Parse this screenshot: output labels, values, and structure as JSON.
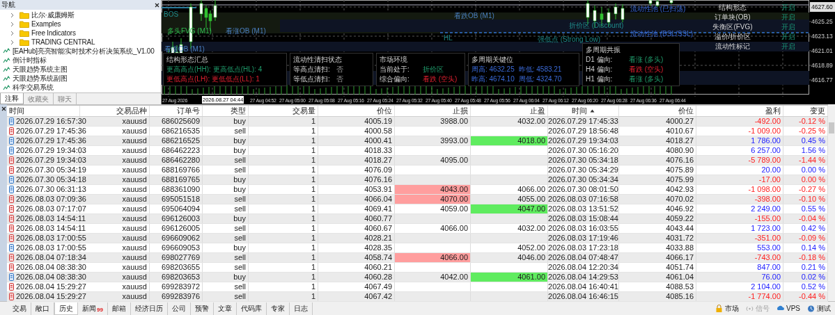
{
  "navigator": {
    "title": "导航",
    "items": [
      {
        "kind": "folder",
        "label": "比尔·威廉姆斯"
      },
      {
        "kind": "folder",
        "label": "Examples"
      },
      {
        "kind": "folder",
        "label": "Free Indicators"
      },
      {
        "kind": "folder",
        "label": "TRADING CENTRAL"
      },
      {
        "kind": "indicator",
        "label": "[EAHub]亮亮智能实时技术分析决策系统_V1.00"
      },
      {
        "kind": "indicator",
        "label": "倒计时指标"
      },
      {
        "kind": "indicator",
        "label": "天眼趋势系统主图"
      },
      {
        "kind": "indicator",
        "label": "天眼趋势系统副图"
      },
      {
        "kind": "indicator",
        "label": "科学交易系统"
      }
    ],
    "tabs": [
      {
        "label": "注释",
        "selected": true
      },
      {
        "label": "收藏夹",
        "selected": false
      },
      {
        "label": "聊天",
        "selected": false
      }
    ]
  },
  "chart": {
    "labels": [
      {
        "text": "BOS"
      },
      {
        "text": "多头FVG (M1)"
      },
      {
        "text": "看涨OB (M1)"
      },
      {
        "text": "看涨OB (M1)"
      },
      {
        "text": "看跌OB (M1)"
      },
      {
        "text": "HL"
      },
      {
        "text": "流动性池 (已扫荡)"
      },
      {
        "text": "折价区 (Discount)"
      },
      {
        "text": "流动性池 (BSL/SSL)"
      },
      {
        "text": "强低点 (Strong Low)"
      }
    ],
    "toggles": [
      {
        "label": "结构形态",
        "state": "开启"
      },
      {
        "label": "订单块(OB)",
        "state": "开启"
      },
      {
        "label": "失衡区(FVG)",
        "state": "开启"
      },
      {
        "label": "溢价/折价区",
        "state": "开启"
      },
      {
        "label": "流动性标记",
        "state": "开启"
      }
    ],
    "panels": [
      {
        "title": "结构形态汇总",
        "rows": [
          {
            "text": "更高高点(HH): 更高低点(HL): 4"
          },
          {
            "text": "更低高点(LH): 更低低点(LL): 1"
          }
        ]
      },
      {
        "title": "流动性清扫状态",
        "rows": [
          {
            "text": "等高点清扫:",
            "value": "否"
          },
          {
            "text": "等低点清扫:",
            "value": "否"
          }
        ]
      },
      {
        "title": "市场环境",
        "rows": [
          {
            "text": "当前处于:",
            "value": "折价区"
          },
          {
            "text": "综合偏向:",
            "value": "看跌 (空头)"
          }
        ]
      },
      {
        "title": "多周期关键位",
        "rows": [
          {
            "text": "周高: 4632.25",
            "value": "昨低: 4583.21"
          },
          {
            "text": "昨高: 4674.10",
            "value": "周低: 4324.70"
          }
        ]
      },
      {
        "title": "多周期共振",
        "rows": [
          {
            "text": "D1 偏向:",
            "value": "看涨 (多头)"
          },
          {
            "text": "H4 偏向:",
            "value": "看跌 (空头)"
          },
          {
            "text": "H1 偏向:",
            "value": "看涨 (多头)"
          }
        ]
      }
    ],
    "price_axis": [
      {
        "text": "4627.60",
        "selected": true
      },
      {
        "text": "4625.25",
        "selected": false
      },
      {
        "text": "4623.13",
        "selected": false
      },
      {
        "text": "4621.01",
        "selected": false
      },
      {
        "text": "4618.89",
        "selected": false
      },
      {
        "text": "4616.77",
        "selected": false
      }
    ],
    "time_axis": [
      "27 Aug 2026",
      "27 Aug 04:52",
      "27 Aug 05:00",
      "27 Aug 05:08",
      "27 Aug 05:16",
      "27 Aug 05:24",
      "27 Aug 05:32",
      "27 Aug 05:40",
      "27 Aug 05:48",
      "27 Aug 05:56",
      "27 Aug 06:04",
      "27 Aug 06:12",
      "27 Aug 06:20",
      "27 Aug 06:28",
      "27 Aug 06:36",
      "27 Aug 06:44"
    ],
    "crosshair_time": "2026.08.27 04:44"
  },
  "table": {
    "columns": [
      "时间",
      "交易品种",
      "订单号",
      "类型",
      "交易量",
      "价位",
      "止损",
      "止盈",
      "时间",
      "价位",
      "盈利",
      "变更"
    ],
    "rows": [
      {
        "kind": "buy",
        "time": "2026.07.29 16:57:30",
        "symbol": "xauusd",
        "order": "686025609",
        "type": "buy",
        "volume": "1",
        "price": "4005.19",
        "sl": "3988.00",
        "tp": "4032.00",
        "sl_hit": false,
        "tp_hit": false,
        "close_time": "2026.07.29 17:45:33",
        "close_price": "4000.27",
        "profit": "-492.00",
        "change": "-0.12 %",
        "loss": true
      },
      {
        "kind": "sell",
        "time": "2026.07.29 17:45:36",
        "symbol": "xauusd",
        "order": "686216535",
        "type": "sell",
        "volume": "1",
        "price": "4000.58",
        "sl_hit": false,
        "tp_hit": false,
        "close_time": "2026.07.29 18:56:48",
        "close_price": "4010.67",
        "profit": "-1 009.00",
        "change": "-0.25 %",
        "loss": true
      },
      {
        "kind": "buy",
        "time": "2026.07.29 17:45:36",
        "symbol": "xauusd",
        "order": "686216525",
        "type": "buy",
        "volume": "1",
        "price": "4000.41",
        "sl": "3993.00",
        "tp": "4018.00",
        "sl_hit": false,
        "tp_hit": true,
        "close_time": "2026.07.29 19:34:03",
        "close_price": "4018.27",
        "profit": "1 786.00",
        "change": "0.45 %",
        "loss": false
      },
      {
        "kind": "buy",
        "time": "2026.07.29 19:34:03",
        "symbol": "xauusd",
        "order": "686462223",
        "type": "buy",
        "volume": "1",
        "price": "4018.33",
        "sl_hit": false,
        "tp_hit": false,
        "close_time": "2026.07.30 05:16:20",
        "close_price": "4080.90",
        "profit": "6 257.00",
        "change": "1.56 %",
        "loss": false
      },
      {
        "kind": "sell",
        "time": "2026.07.29 19:34:03",
        "symbol": "xauusd",
        "order": "686462280",
        "type": "sell",
        "volume": "1",
        "price": "4018.27",
        "sl": "4095.00",
        "sl_hit": false,
        "tp_hit": false,
        "close_time": "2026.07.30 05:34:18",
        "close_price": "4076.16",
        "profit": "-5 789.00",
        "change": "-1.44 %",
        "loss": true
      },
      {
        "kind": "sell",
        "time": "2026.07.30 05:34:19",
        "symbol": "xauusd",
        "order": "688169766",
        "type": "sell",
        "volume": "1",
        "price": "4076.09",
        "sl_hit": false,
        "tp_hit": false,
        "close_time": "2026.07.30 05:34:29",
        "close_price": "4075.89",
        "profit": "20.00",
        "change": "0.00 %",
        "loss": false
      },
      {
        "kind": "buy",
        "time": "2026.07.30 05:34:18",
        "symbol": "xauusd",
        "order": "688169765",
        "type": "buy",
        "volume": "1",
        "price": "4076.16",
        "sl_hit": false,
        "tp_hit": false,
        "close_time": "2026.07.30 05:34:34",
        "close_price": "4075.99",
        "profit": "-17.00",
        "change": "0.00 %",
        "loss": true
      },
      {
        "kind": "buy",
        "time": "2026.07.30 06:31:13",
        "symbol": "xauusd",
        "order": "688361090",
        "type": "buy",
        "volume": "1",
        "price": "4053.91",
        "sl": "4043.00",
        "tp": "4066.00",
        "sl_hit": true,
        "tp_hit": false,
        "close_time": "2026.07.30 08:01:50",
        "close_price": "4042.93",
        "profit": "-1 098.00",
        "change": "-0.27 %",
        "loss": true
      },
      {
        "kind": "sell",
        "time": "2026.08.03 07:09:36",
        "symbol": "xauusd",
        "order": "695051518",
        "type": "sell",
        "volume": "1",
        "price": "4066.04",
        "sl": "4070.00",
        "tp": "4055.00",
        "sl_hit": true,
        "tp_hit": false,
        "close_time": "2026.08.03 07:16:58",
        "close_price": "4070.02",
        "profit": "-398.00",
        "change": "-0.10 %",
        "loss": true
      },
      {
        "kind": "sell",
        "time": "2026.08.03 07:17:07",
        "symbol": "xauusd",
        "order": "695064094",
        "type": "sell",
        "volume": "1",
        "price": "4069.41",
        "sl": "4059.00",
        "tp": "4047.00",
        "sl_hit": false,
        "tp_hit": true,
        "close_time": "2026.08.03 13:51:52",
        "close_price": "4046.92",
        "profit": "2 249.00",
        "change": "0.55 %",
        "loss": false
      },
      {
        "kind": "sell",
        "time": "2026.08.03 14:54:11",
        "symbol": "xauusd",
        "order": "696126003",
        "type": "buy",
        "volume": "1",
        "price": "4060.77",
        "sl_hit": false,
        "tp_hit": false,
        "close_time": "2026.08.03 15:08:44",
        "close_price": "4059.22",
        "profit": "-155.00",
        "change": "-0.04 %",
        "loss": true
      },
      {
        "kind": "sell",
        "time": "2026.08.03 14:54:11",
        "symbol": "xauusd",
        "order": "696126005",
        "type": "sell",
        "volume": "1",
        "price": "4060.67",
        "sl": "4066.00",
        "tp": "4032.00",
        "sl_hit": false,
        "tp_hit": false,
        "close_time": "2026.08.03 16:03:55",
        "close_price": "4043.44",
        "profit": "1 723.00",
        "change": "0.42 %",
        "loss": false
      },
      {
        "kind": "sell",
        "time": "2026.08.03 17:00:55",
        "symbol": "xauusd",
        "order": "696609062",
        "type": "sell",
        "volume": "1",
        "price": "4028.21",
        "sl_hit": false,
        "tp_hit": false,
        "close_time": "2026.08.03 17:19:46",
        "close_price": "4031.72",
        "profit": "-351.00",
        "change": "-0.09 %",
        "loss": true
      },
      {
        "kind": "buy",
        "time": "2026.08.03 17:00:55",
        "symbol": "xauusd",
        "order": "696609053",
        "type": "buy",
        "volume": "1",
        "price": "4028.35",
        "tp": "4052.00",
        "sl_hit": false,
        "tp_hit": false,
        "close_time": "2026.08.03 17:23:18",
        "close_price": "4033.88",
        "profit": "553.00",
        "change": "0.14 %",
        "loss": false
      },
      {
        "kind": "sell",
        "time": "2026.08.04 07:18:34",
        "symbol": "xauusd",
        "order": "698027769",
        "type": "sell",
        "volume": "1",
        "price": "4058.74",
        "sl": "4066.00",
        "tp": "4046.00",
        "sl_hit": true,
        "tp_hit": false,
        "close_time": "2026.08.04 07:48:47",
        "close_price": "4066.17",
        "profit": "-743.00",
        "change": "-0.18 %",
        "loss": true
      },
      {
        "kind": "sell",
        "time": "2026.08.04 08:38:30",
        "symbol": "xauusd",
        "order": "698203655",
        "type": "sell",
        "volume": "1",
        "price": "4060.21",
        "sl_hit": false,
        "tp_hit": false,
        "close_time": "2026.08.04 12:20:34",
        "close_price": "4051.74",
        "profit": "847.00",
        "change": "0.21 %",
        "loss": false
      },
      {
        "kind": "buy",
        "time": "2026.08.04 08:38:30",
        "symbol": "xauusd",
        "order": "698203653",
        "type": "buy",
        "volume": "1",
        "price": "4060.28",
        "sl": "4042.00",
        "tp": "4061.00",
        "sl_hit": false,
        "tp_hit": true,
        "close_time": "2026.08.04 14:29:53",
        "close_price": "4061.04",
        "profit": "76.00",
        "change": "0.02 %",
        "loss": false
      },
      {
        "kind": "sell",
        "time": "2026.08.04 15:29:27",
        "symbol": "xauusd",
        "order": "699283972",
        "type": "sell",
        "volume": "1",
        "price": "4067.49",
        "sl_hit": false,
        "tp_hit": false,
        "close_time": "2026.08.04 16:40:41",
        "close_price": "4088.53",
        "profit": "2 104.00",
        "change": "0.52 %",
        "loss": false
      },
      {
        "kind": "sell",
        "time": "2026.08.04 15:29:27",
        "symbol": "xauusd",
        "order": "699283976",
        "type": "sell",
        "volume": "1",
        "price": "4067.42",
        "sl_hit": false,
        "tp_hit": false,
        "close_time": "2026.08.04 16:46:15",
        "close_price": "4085.16",
        "profit": "-1 774.00",
        "change": "-0.44 %",
        "loss": true
      }
    ]
  },
  "bottom_tabs": [
    {
      "label": "交易",
      "selected": false
    },
    {
      "label": "敞口",
      "selected": false
    },
    {
      "label": "历史",
      "selected": true
    },
    {
      "label": "新闻",
      "selected": false,
      "badge": "99"
    },
    {
      "label": "邮箱",
      "selected": false
    },
    {
      "label": "经济日历",
      "selected": false
    },
    {
      "label": "公司",
      "selected": false
    },
    {
      "label": "预警",
      "selected": false
    },
    {
      "label": "文章",
      "selected": false
    },
    {
      "label": "代码库",
      "selected": false
    },
    {
      "label": "专家",
      "selected": false
    },
    {
      "label": "日志",
      "selected": false
    }
  ],
  "status_items": [
    {
      "kind": "market",
      "label": "市场",
      "disabled": false
    },
    {
      "kind": "signal",
      "label": "信号",
      "disabled": true
    },
    {
      "kind": "vps",
      "label": "VPS",
      "disabled": false
    },
    {
      "kind": "tester",
      "label": "测试",
      "disabled": false
    }
  ]
}
